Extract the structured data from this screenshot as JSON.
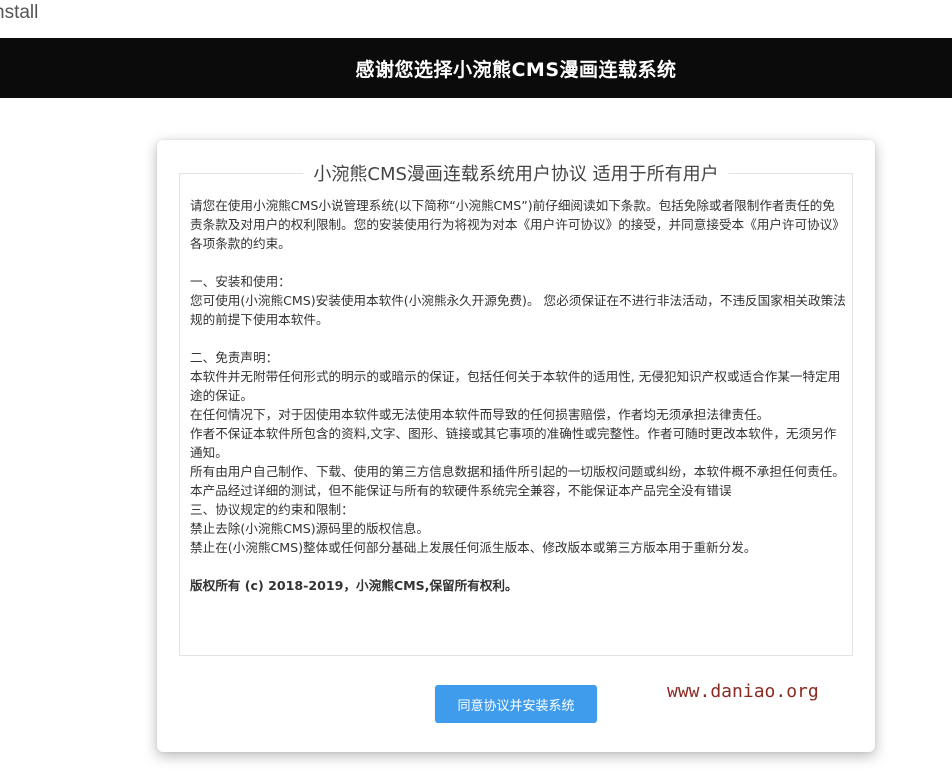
{
  "browser": {
    "title_fragment": "nstall"
  },
  "header": {
    "title": "感谢您选择小涴熊CMS漫画连载系统"
  },
  "agreement": {
    "legend": "小涴熊CMS漫画连载系统用户协议 适用于所有用户",
    "intro": "请您在使用小涴熊CMS小说管理系统(以下简称“小涴熊CMS”)前仔细阅读如下条款。包括免除或者限制作者责任的免责条款及对用户的权利限制。您的安装使用行为将视为对本《用户许可协议》的接受，并同意接受本《用户许可协议》各项条款的约束。",
    "section1_title": "一、安装和使用：",
    "section1_text": "您可使用(小涴熊CMS)安装使用本软件(小涴熊永久开源免费)。 您必须保证在不进行非法活动，不违反国家相关政策法规的前提下使用本软件。",
    "section2_title": "二、免责声明：",
    "section2_lines": [
      "本软件并无附带任何形式的明示的或暗示的保证，包括任何关于本软件的适用性, 无侵犯知识产权或适合作某一特定用途的保证。",
      "在任何情况下，对于因使用本软件或无法使用本软件而导致的任何损害赔偿，作者均无须承担法律责任。",
      "作者不保证本软件所包含的资料,文字、图形、链接或其它事项的准确性或完整性。作者可随时更改本软件，无须另作通知。",
      "所有由用户自己制作、下载、使用的第三方信息数据和插件所引起的一切版权问题或纠纷，本软件概不承担任何责任。",
      "本产品经过详细的测试，但不能保证与所有的软硬件系统完全兼容，不能保证本产品完全没有错误"
    ],
    "section3_title": "三、协议规定的约束和限制：",
    "section3_lines": [
      "禁止去除(小涴熊CMS)源码里的版权信息。",
      "禁止在(小涴熊CMS)整体或任何部分基础上发展任何派生版本、修改版本或第三方版本用于重新分发。"
    ],
    "copyright": "版权所有 (c) 2018-2019，小涴熊CMS,保留所有权利。"
  },
  "actions": {
    "agree_label": "同意协议并安装系统"
  },
  "watermark": {
    "text": "www.daniao.org"
  },
  "colors": {
    "header_bg": "#0b0b0b",
    "button_bg": "#3f9cec",
    "watermark": "#8b2a22"
  }
}
